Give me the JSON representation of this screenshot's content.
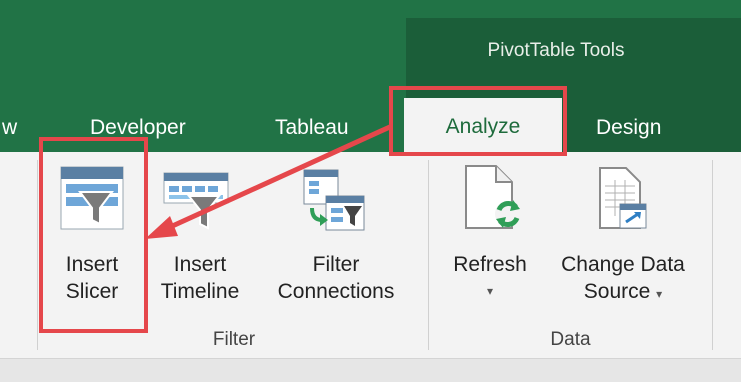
{
  "header": {
    "context_title": "PivotTable Tools",
    "partial_tab_label": "w"
  },
  "tabs": [
    {
      "label": "Developer"
    },
    {
      "label": "Tableau"
    },
    {
      "label": "Analyze"
    },
    {
      "label": "Design"
    }
  ],
  "groups": {
    "filter": {
      "label": "Filter",
      "commands": [
        {
          "line1": "Insert",
          "line2": "Slicer"
        },
        {
          "line1": "Insert",
          "line2": "Timeline"
        },
        {
          "line1": "Filter",
          "line2": "Connections"
        }
      ]
    },
    "data": {
      "label": "Data",
      "commands": [
        {
          "line1": "Refresh",
          "caret": "▾"
        },
        {
          "line1": "Change Data",
          "line2": "Source",
          "caret": "▾"
        }
      ]
    }
  },
  "colors": {
    "ribbon_green": "#217346",
    "context_green": "#1b5e39",
    "highlight_red": "#e5474b"
  }
}
